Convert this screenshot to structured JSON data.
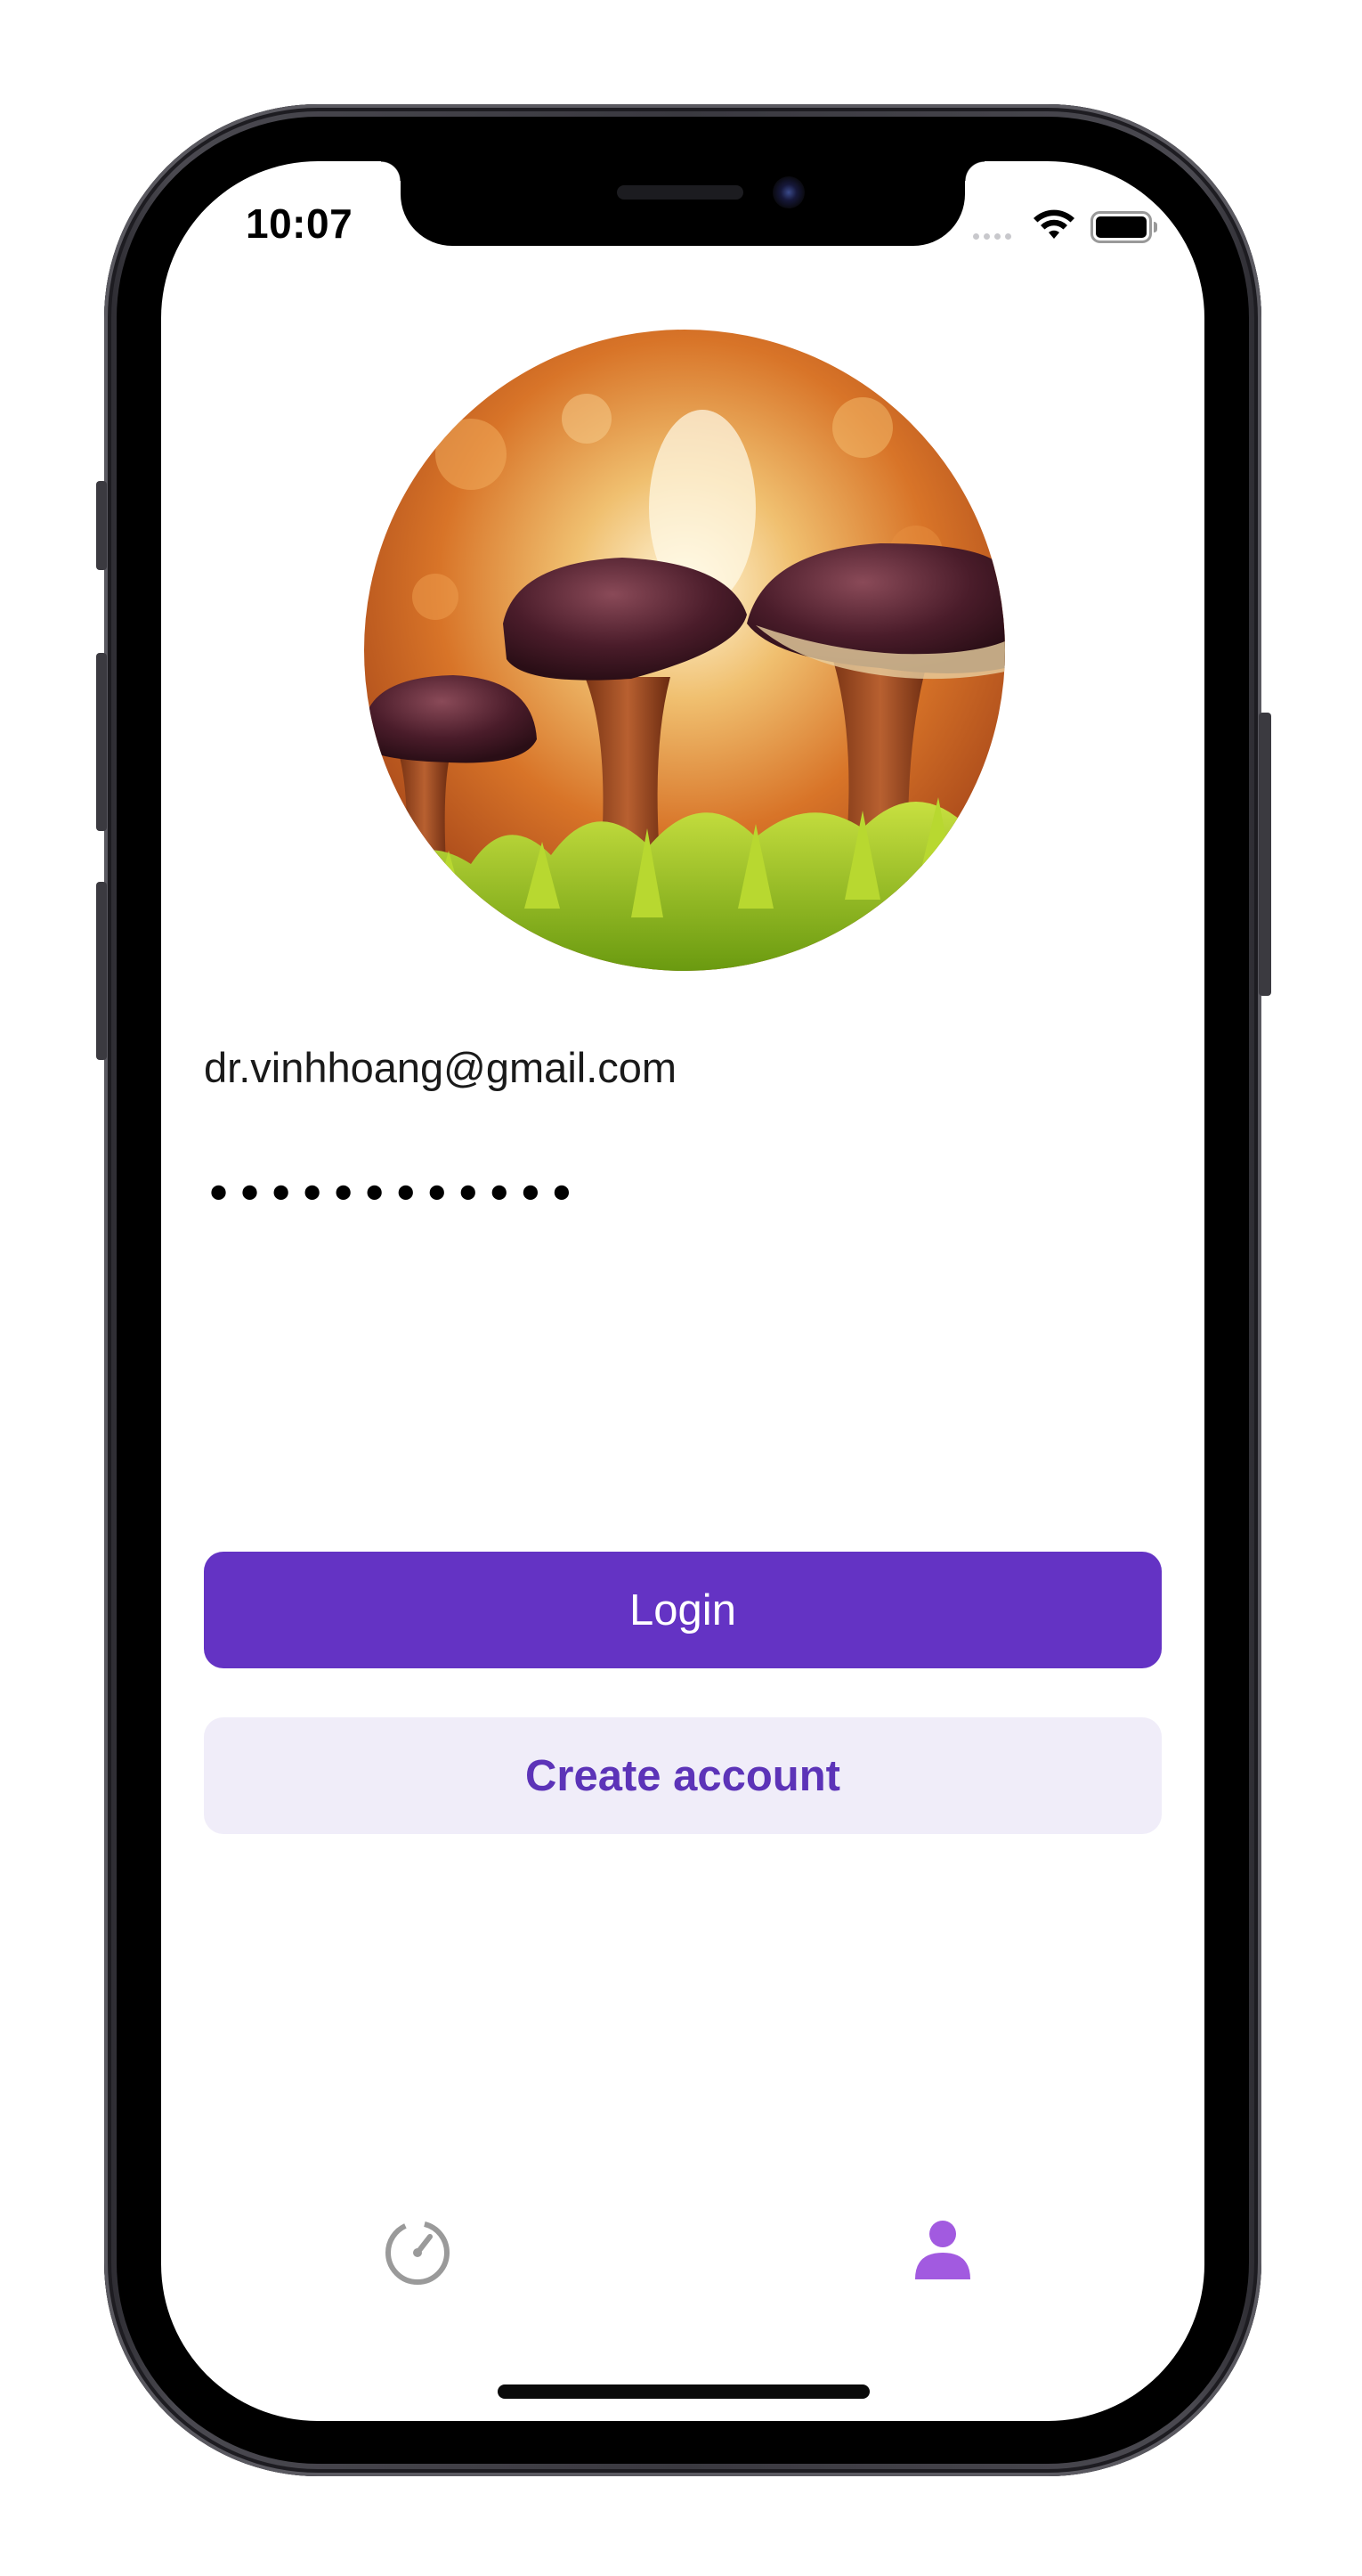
{
  "status_bar": {
    "time": "10:07",
    "wifi_icon": "wifi-icon",
    "battery_icon": "battery-icon",
    "signal_icon": "cellular-dots-icon"
  },
  "profile": {
    "avatar_description_icon": "mushroom-photo"
  },
  "login_form": {
    "email_value": "dr.vinhhoang@gmail.com",
    "password_masked": "••••••••••••"
  },
  "buttons": {
    "login_label": "Login",
    "create_account_label": "Create account"
  },
  "tab_bar": {
    "tabs": [
      {
        "icon": "timer-icon",
        "active": false
      },
      {
        "icon": "person-icon",
        "active": true
      }
    ]
  },
  "colors": {
    "primary": "#6433c4",
    "secondary_bg": "#f0edf9",
    "secondary_text": "#5c33b8",
    "tab_active": "#a25ae0",
    "tab_inactive": "#9a9a9a"
  }
}
